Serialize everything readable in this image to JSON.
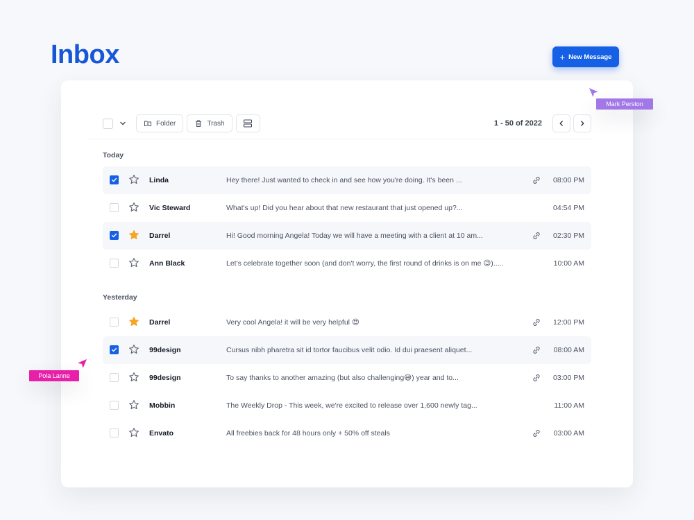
{
  "page_title": "Inbox",
  "new_message_label": "New Message",
  "toolbar": {
    "folder_label": "Folder",
    "trash_label": "Trash",
    "pagination": "1 - 50 of 2022"
  },
  "colors": {
    "accent": "#1660e6",
    "title": "#1657d8",
    "star_filled": "#f5a623",
    "cursor_mark": "#a277e8",
    "cursor_pola": "#e81fa9"
  },
  "sections": [
    {
      "label": "Today",
      "messages": [
        {
          "sender": "Linda",
          "preview": "Hey there! Just wanted to check in and see how you're doing. It's been ...",
          "time": "08:00 PM",
          "checked": true,
          "starred": false,
          "has_link": true
        },
        {
          "sender": "Vic Steward",
          "preview": "What's up! Did you hear about that new restaurant that just opened up?...",
          "time": "04:54 PM",
          "checked": false,
          "starred": false,
          "has_link": false
        },
        {
          "sender": "Darrel",
          "preview": "Hi! Good morning Angela! Today we will have a meeting with a client at 10 am...",
          "time": "02:30 PM",
          "checked": true,
          "starred": true,
          "has_link": true
        },
        {
          "sender": "Ann Black",
          "preview": "Let's celebrate together soon (and don't worry, the first round of drinks is on me 😉).....",
          "time": "10:00 AM",
          "checked": false,
          "starred": false,
          "has_link": false
        }
      ]
    },
    {
      "label": "Yesterday",
      "messages": [
        {
          "sender": "Darrel",
          "preview": "Very cool Angela! it will be very helpful 😍",
          "time": "12:00 PM",
          "checked": false,
          "starred": true,
          "has_link": true
        },
        {
          "sender": "99design",
          "preview": "Cursus nibh pharetra sit id tortor faucibus velit odio. Id dui praesent aliquet...",
          "time": "08:00 AM",
          "checked": true,
          "starred": false,
          "has_link": true
        },
        {
          "sender": "99design",
          "preview": "To say thanks to another amazing (but also challenging😅) year and to...",
          "time": "03:00 PM",
          "checked": false,
          "starred": false,
          "has_link": true
        },
        {
          "sender": "Mobbin",
          "preview": "The Weekly Drop - This week, we're excited to release over 1,600 newly tag...",
          "time": "11:00 AM",
          "checked": false,
          "starred": false,
          "has_link": false
        },
        {
          "sender": "Envato",
          "preview": "All freebies back for 48 hours only + 50% off steals",
          "time": "03:00 AM",
          "checked": false,
          "starred": false,
          "has_link": true
        }
      ]
    }
  ],
  "collaborators": [
    {
      "name": "Mark Perston"
    },
    {
      "name": "Pola Lanne"
    }
  ]
}
